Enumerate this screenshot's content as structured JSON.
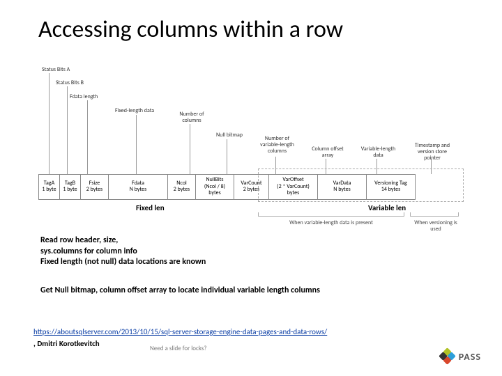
{
  "title": "Accessing columns within a row",
  "top_labels": {
    "status_a": "Status Bits A",
    "status_b": "Status Bits B",
    "fdata_len": "Fdata length",
    "fixed_len_data": "Fixed-length data",
    "num_cols": "Number of columns",
    "null_bitmap": "Null bitmap",
    "num_var_cols": "Number of variable-length columns",
    "col_offset": "Column offset array",
    "var_len_data": "Variable-length data",
    "timestamp": "Timestamp and version store pointer"
  },
  "columns": [
    {
      "name": "TagA",
      "size": "1 byte"
    },
    {
      "name": "TagB",
      "size": "1 byte"
    },
    {
      "name": "Fsize",
      "size": "2 bytes"
    },
    {
      "name": "Fdata",
      "size": "N bytes"
    },
    {
      "name": "Ncol",
      "size": "2 bytes"
    },
    {
      "name": "NullBits",
      "size": "(Ncol / 8) bytes"
    },
    {
      "name": "VarCount",
      "size": "2 bytes"
    },
    {
      "name": "VarOffset",
      "size": "(2 * VarCount) bytes"
    },
    {
      "name": "VarData",
      "size": "N bytes"
    },
    {
      "name": "Versioning Tag",
      "size": "14 bytes"
    }
  ],
  "groups": {
    "fixed": "Fixed len",
    "variable": "Variable len"
  },
  "notes": {
    "when_var": "When variable-length data is present",
    "when_ver": "When versioning is used"
  },
  "para1_l1": "Read row header, size,",
  "para1_l2": "sys.columns for column info",
  "para1_l3": "Fixed length (not null) data locations are known",
  "para2": "Get Null bitmap, column offset array to locate individual variable length columns",
  "link": "https://aboutsqlserver.com/2013/10/15/sql-server-storage-engine-data-pages-and-data-rows/",
  "author": ", Dmitri Korotkevitch",
  "tiny": "Need a slide for locks?",
  "logo": "PASS"
}
